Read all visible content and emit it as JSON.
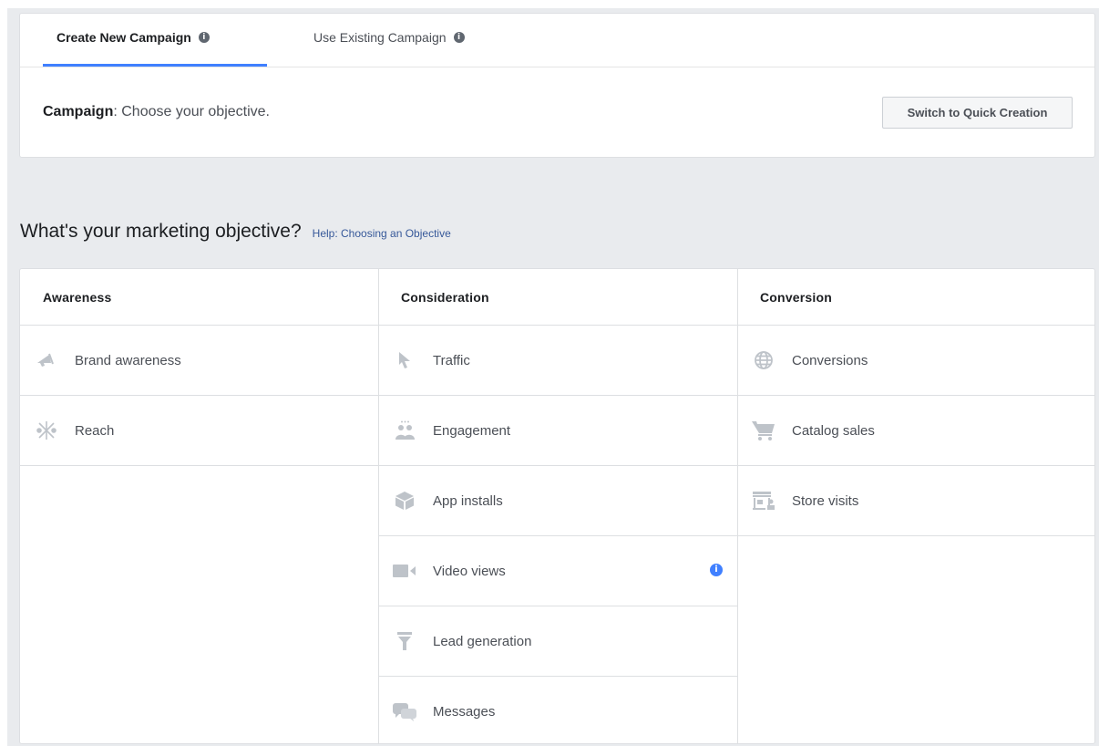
{
  "tabs": {
    "create_label": "Create New Campaign",
    "existing_label": "Use Existing Campaign"
  },
  "campaign": {
    "label": "Campaign",
    "text": ": Choose your objective."
  },
  "quick_creation_button": "Switch to Quick Creation",
  "objective": {
    "title": "What's your marketing objective?",
    "help_link": "Help: Choosing an Objective"
  },
  "columns": {
    "awareness": {
      "header": "Awareness",
      "items": [
        "Brand awareness",
        "Reach"
      ]
    },
    "consideration": {
      "header": "Consideration",
      "items": [
        "Traffic",
        "Engagement",
        "App installs",
        "Video views",
        "Lead generation",
        "Messages"
      ]
    },
    "conversion": {
      "header": "Conversion",
      "items": [
        "Conversions",
        "Catalog sales",
        "Store visits"
      ]
    }
  },
  "colors": {
    "accent": "#4080ff",
    "icon_gray": "#bec3c9",
    "link": "#365899"
  }
}
